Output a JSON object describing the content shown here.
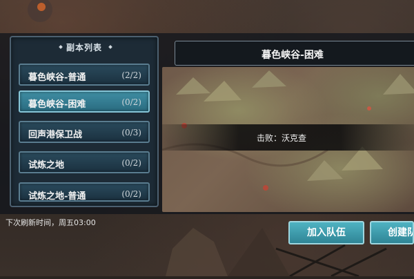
{
  "list": {
    "title": "副本列表",
    "items": [
      {
        "name": "暮色峡谷-普通",
        "count": "(2/2)"
      },
      {
        "name": "暮色峡谷-困难",
        "count": "(0/2)"
      },
      {
        "name": "回声港保卫战",
        "count": "(0/3)"
      },
      {
        "name": "试炼之地",
        "count": "(0/2)"
      },
      {
        "name": "试炼之地-普通",
        "count": "(0/2)"
      }
    ],
    "selected_index": 1
  },
  "refresh_text": "下次刷新时间，周五03:00",
  "detail": {
    "title": "暮色峡谷-困难",
    "defeat_text": "击败：沃克查"
  },
  "actions": {
    "join_label": "加入队伍",
    "create_label": "创建队"
  },
  "colors": {
    "accent": "#3f8ea3",
    "button": "#4fb3c2"
  }
}
